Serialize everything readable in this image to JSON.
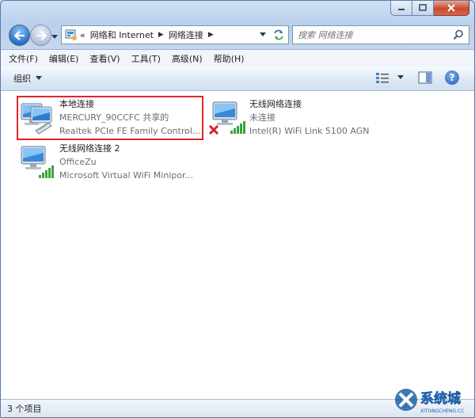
{
  "window": {
    "caption_buttons": [
      "minimize",
      "maximize",
      "close"
    ]
  },
  "address": {
    "root_glyph": "«",
    "breadcrumb": [
      "网络和 Internet",
      "网络连接"
    ],
    "separator": "▶"
  },
  "search": {
    "placeholder": "搜索 网络连接"
  },
  "menu": [
    "文件(F)",
    "编辑(E)",
    "查看(V)",
    "工具(T)",
    "高级(N)",
    "帮助(H)"
  ],
  "toolbar": {
    "organize_label": "组织",
    "help_label": "?"
  },
  "connections": [
    {
      "name": "本地连接",
      "line2": "MERCURY_90CCFC 共享的",
      "line3": "Realtek PCIe FE Family Control...",
      "icon": "wired-network-icon",
      "selected": true
    },
    {
      "name": "无线网络连接",
      "line2": "未连接",
      "line3": "Intel(R) WiFi Link 5100 AGN",
      "icon": "wireless-network-disconnected-icon",
      "selected": false
    },
    {
      "name": "无线网络连接 2",
      "line2": "OfficeZu",
      "line3": "Microsoft Virtual WiFi Minipor...",
      "icon": "wireless-network-icon",
      "selected": false
    }
  ],
  "status": {
    "item_count": "3 个项目"
  },
  "watermark": {
    "text": "系统城",
    "subtext": "XITONGCHENG.CC"
  },
  "colors": {
    "selection_border": "#e0252d",
    "accent": "#1d5db6"
  }
}
